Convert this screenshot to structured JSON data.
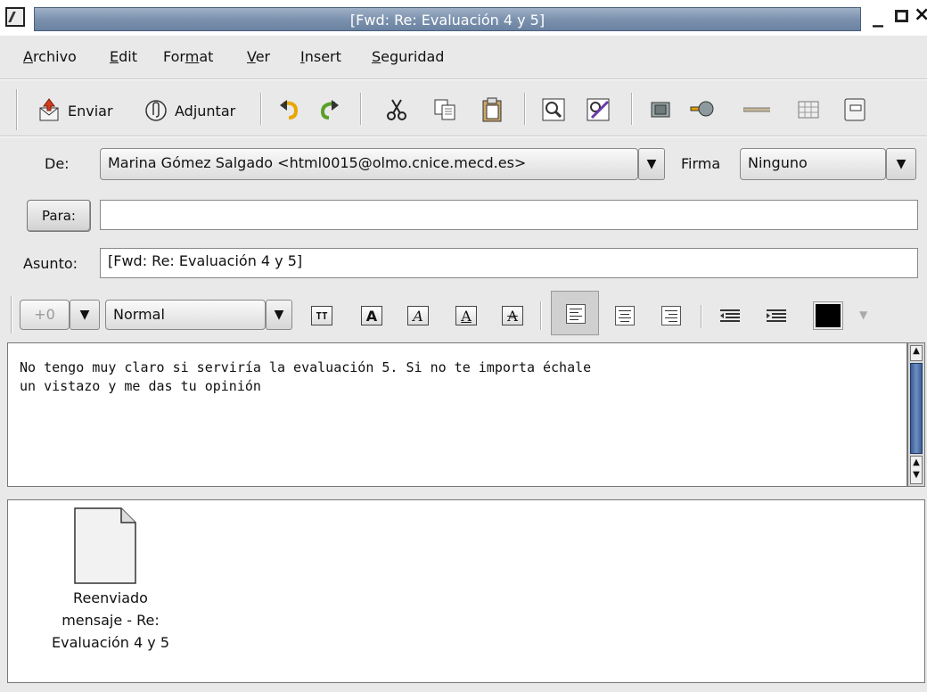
{
  "window": {
    "title": "[Fwd: Re: Evaluación 4 y 5]"
  },
  "menu": {
    "items": [
      {
        "label": "Archivo"
      },
      {
        "label": "Edit"
      },
      {
        "label": "Format"
      },
      {
        "label": "Ver"
      },
      {
        "label": "Insert"
      },
      {
        "label": "Seguridad"
      }
    ]
  },
  "toolbar": {
    "send_label": "Enviar",
    "attach_label": "Adjuntar",
    "icons": [
      "send-icon",
      "attach-icon",
      "undo-icon",
      "redo-icon",
      "cut-icon",
      "copy-icon",
      "paste-icon",
      "find-icon",
      "spellcheck-icon",
      "image-icon",
      "link-icon",
      "horizontal-line-icon",
      "table-icon",
      "anchor-icon"
    ]
  },
  "form": {
    "from_label": "De:",
    "from_value": "Marina Gómez Salgado <html0015@olmo.cnice.mecd.es>",
    "signature_label": "Firma",
    "signature_value": "Ninguno",
    "to_button": "Para:",
    "to_value": "",
    "subject_label": "Asunto:",
    "subject_value": "[Fwd: Re: Evaluación 4 y 5]"
  },
  "format_bar": {
    "size_value": "+0",
    "style_value": "Normal",
    "buttons": [
      "TT",
      "A",
      "A",
      "A",
      "A"
    ],
    "color_value": "#000000"
  },
  "message": {
    "body_line1": "No tengo muy claro si serviría la evaluación 5. Si no te importa échale",
    "body_line2": "un vistazo y me das tu opinión"
  },
  "attachment": {
    "line1": "Reenviado",
    "line2": "mensaje - Re:",
    "line3": "Evaluación 4 y 5"
  }
}
